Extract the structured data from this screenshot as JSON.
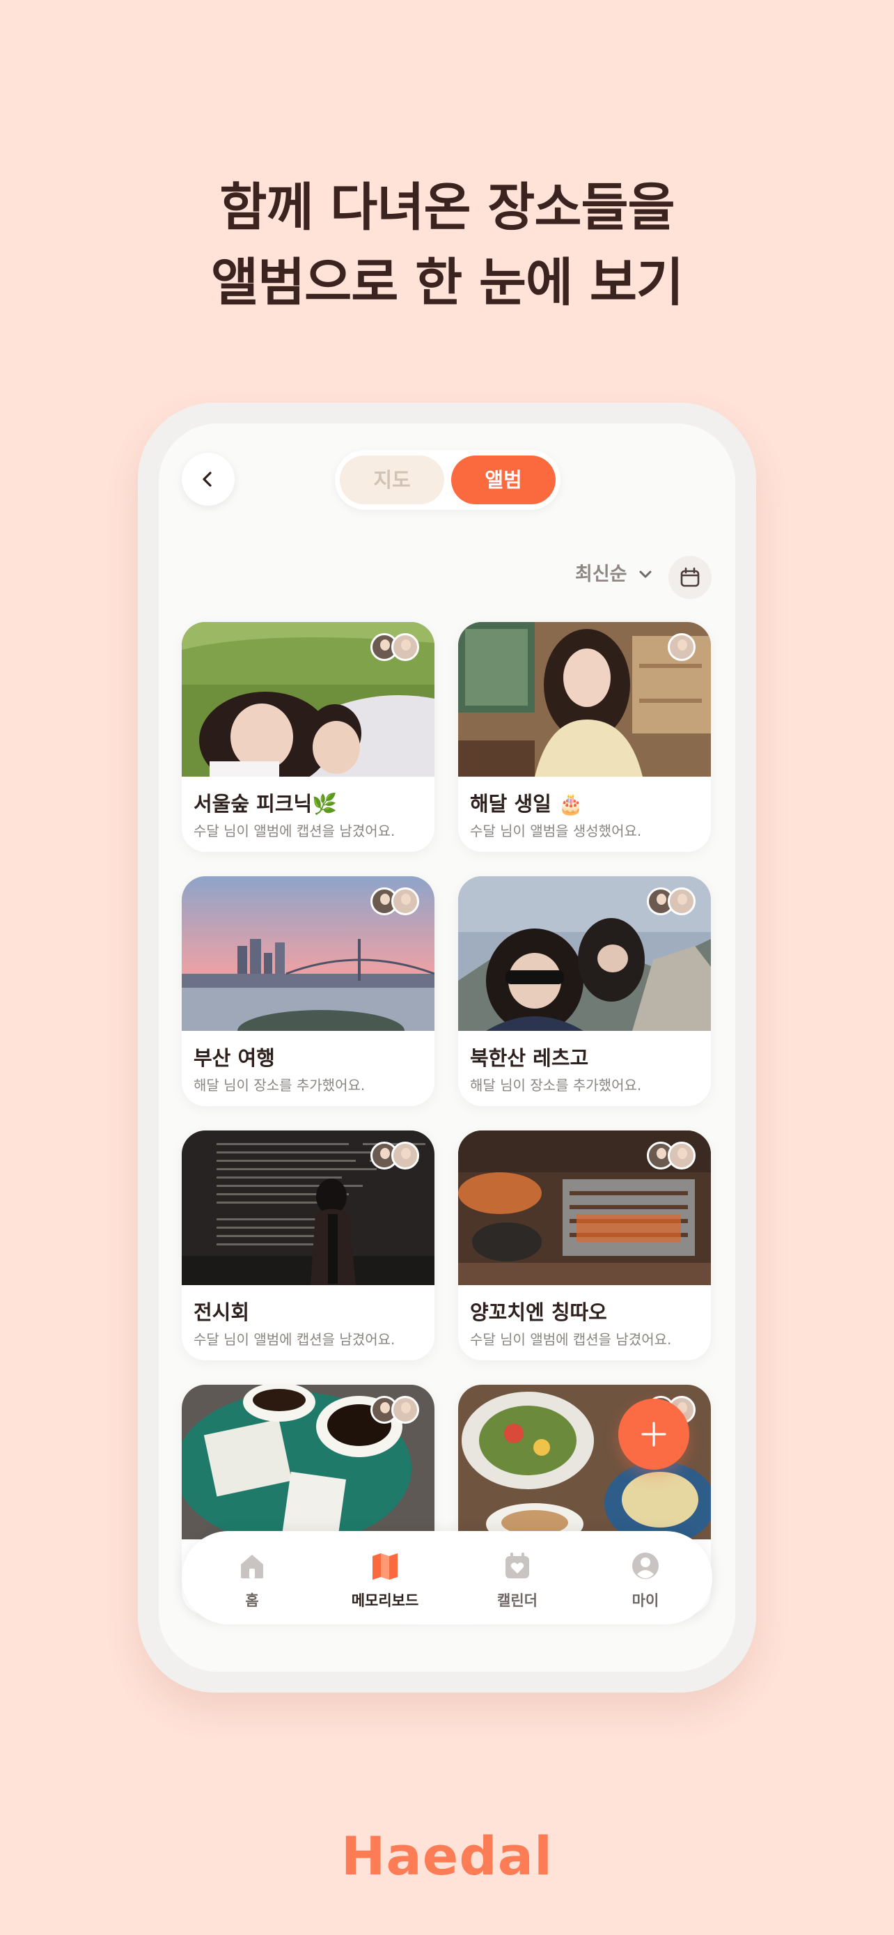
{
  "headline": {
    "line1": "함께 다녀온 장소들을",
    "line2": "앨범으로 한 눈에 보기"
  },
  "header": {
    "segment_map": "지도",
    "segment_album": "앨범",
    "active_segment": "앨범"
  },
  "sort": {
    "label": "최신순"
  },
  "albums": [
    {
      "title": "서울숲 피크닉🌿",
      "subtitle": "수달 님이 앨범에 캡션을 남겼어요."
    },
    {
      "title": "해달 생일 🎂",
      "subtitle": "수달 님이 앨범을 생성했어요."
    },
    {
      "title": "부산 여행",
      "subtitle": "해달 님이 장소를 추가했어요."
    },
    {
      "title": "북한산 레츠고",
      "subtitle": "해달 님이 장소를 추가했어요."
    },
    {
      "title": "전시회",
      "subtitle": "수달 님이 앨범에 캡션을 남겼어요."
    },
    {
      "title": "양꼬치엔 칭따오",
      "subtitle": "수달 님이 앨범에 캡션을 남겼어요."
    }
  ],
  "tabbar": {
    "items": [
      {
        "label": "홈",
        "icon": "home-icon"
      },
      {
        "label": "메모리보드",
        "icon": "memory-board-icon"
      },
      {
        "label": "캘린더",
        "icon": "calendar-heart-icon"
      },
      {
        "label": "마이",
        "icon": "profile-icon"
      }
    ],
    "active": "메모리보드"
  },
  "colors": {
    "accent": "#fb6a3f",
    "background": "#ffe2d8",
    "brand": "#fb7c55"
  },
  "brand": {
    "name": "Haedal"
  }
}
